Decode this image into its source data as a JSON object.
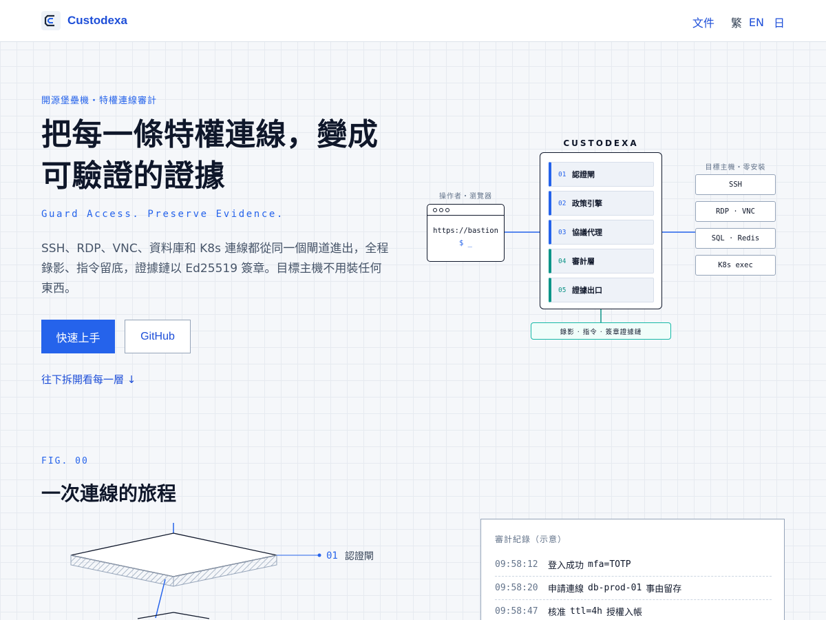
{
  "header": {
    "brand": "Custodexa",
    "nav_docs": "文件",
    "languages": [
      {
        "label": "繁",
        "active": true
      },
      {
        "label": "EN",
        "active": false
      },
      {
        "label": "日",
        "active": false
      }
    ]
  },
  "hero": {
    "eyebrow": "開源堡壘機・特權連線審計",
    "headline": "把每一條特權連線，變成可驗證的證據",
    "tagline": "Guard Access. Preserve Evidence.",
    "lead": "SSH、RDP、VNC、資料庫和 K8s 連線都從同一個閘道進出，全程錄影、指令留底，證據鏈以 Ed25519 簽章。目標主機不用裝任何東西。",
    "primary_button": "快速上手",
    "secondary_button": "GitHub",
    "scroll_link": "往下拆開看每一層 ↓"
  },
  "diagram": {
    "title": "CUSTODEXA",
    "operator_label": "操作者・瀏覽器",
    "operator_url": "https://bastion",
    "operator_prompt": "$ _",
    "layers": [
      {
        "num": "01",
        "name": "認證閘",
        "accent": "blue"
      },
      {
        "num": "02",
        "name": "政策引擎",
        "accent": "blue"
      },
      {
        "num": "03",
        "name": "協議代理",
        "accent": "blue"
      },
      {
        "num": "04",
        "name": "審計層",
        "accent": "teal"
      },
      {
        "num": "05",
        "name": "證據出口",
        "accent": "teal"
      }
    ],
    "targets_label": "目標主機・零安裝",
    "targets": [
      "SSH",
      "RDP · VNC",
      "SQL · Redis",
      "K8s exec"
    ],
    "evidence_box": "錄影 · 指令 · 簽章證據鏈"
  },
  "journey": {
    "fig_label": "FIG. 00",
    "title": "一次連線的旅程",
    "callout_num": "01",
    "callout_text": "認證閘"
  },
  "audit": {
    "title": "審計紀錄（示意）",
    "rows": [
      {
        "time": "09:58:12",
        "event": "登入成功",
        "value": "mfa=TOTP",
        "note": ""
      },
      {
        "time": "09:58:20",
        "event": "申請連線",
        "value": "db-prod-01",
        "note": "事由留存"
      },
      {
        "time": "09:58:47",
        "event": "核准",
        "value": "ttl=4h",
        "note": "授權入帳"
      }
    ]
  },
  "colors": {
    "accent": "#2563eb",
    "teal": "#0d9488",
    "ink": "#0f172a"
  }
}
